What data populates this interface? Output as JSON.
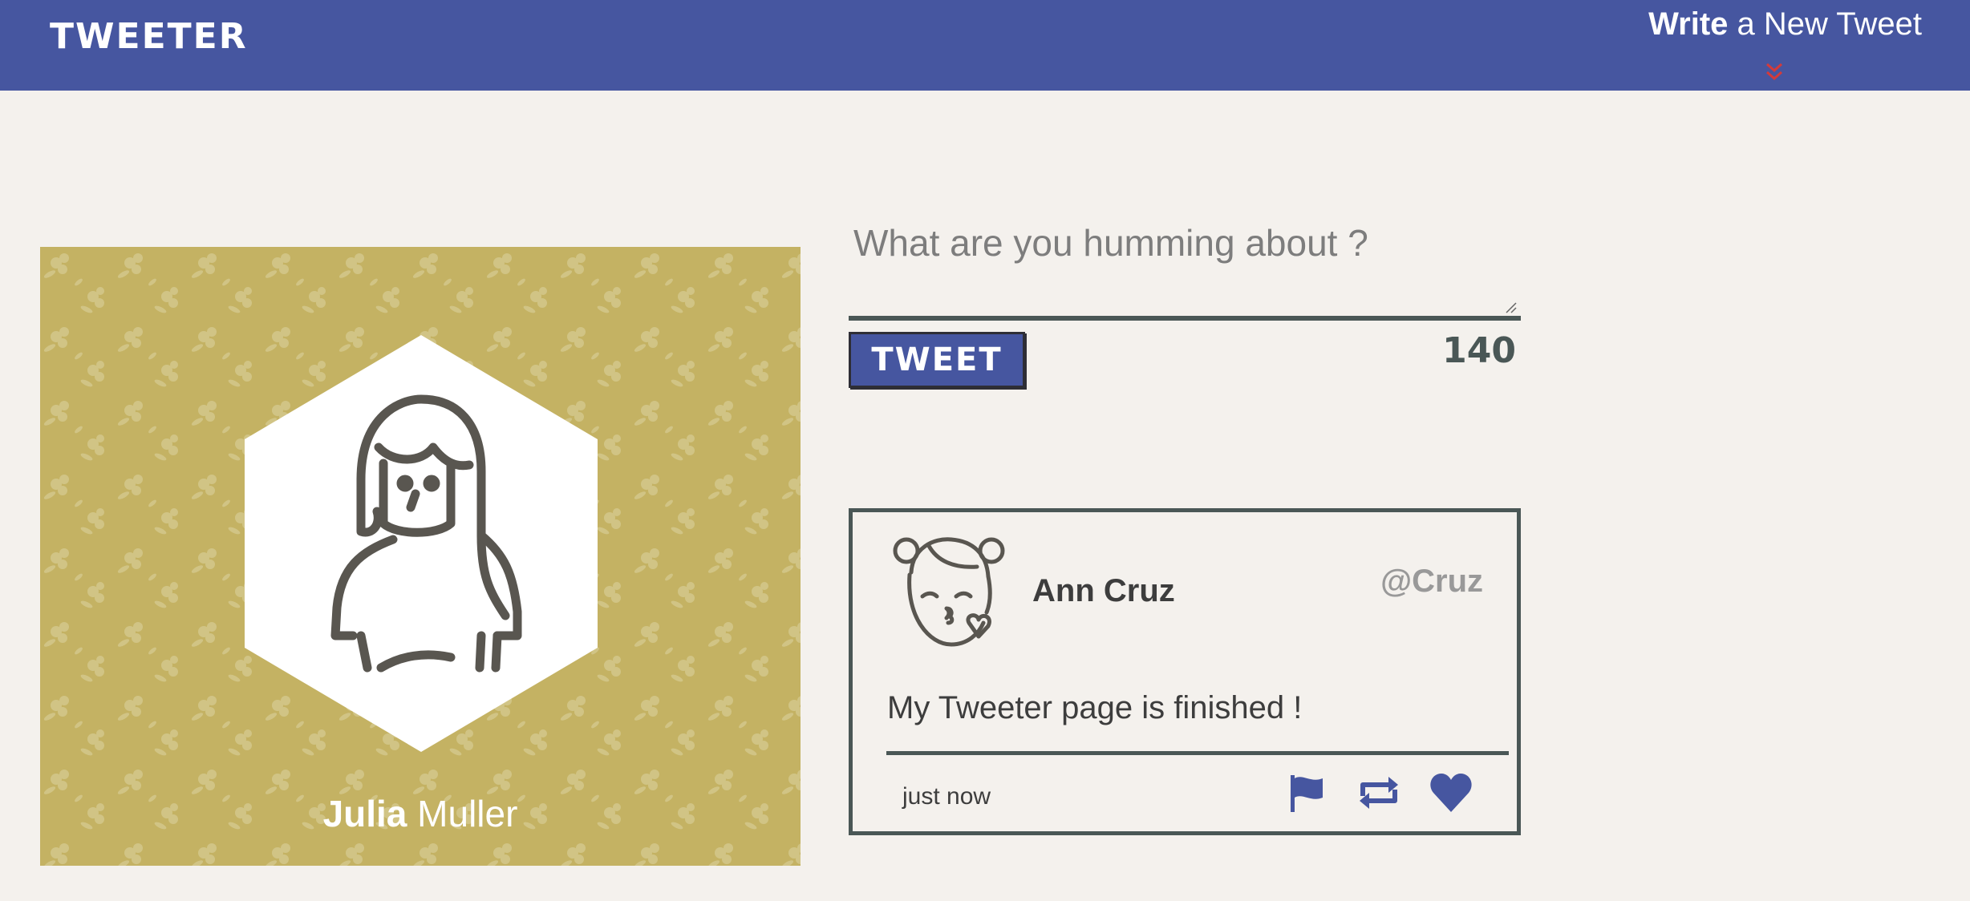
{
  "app": {
    "logo": "TWEETER",
    "nav_toggle": {
      "bold": "Write",
      "rest": " a New Tweet"
    }
  },
  "profile": {
    "first_name": "Julia",
    "last_name": " Muller"
  },
  "composer": {
    "placeholder": "What are you humming about ?",
    "button_label": "TWEET",
    "char_count": "140"
  },
  "tweet": {
    "name": "Ann Cruz",
    "handle": "@Cruz",
    "text": "My Tweeter page is finished !",
    "time": "just now",
    "actions": [
      "flag-icon",
      "retweet-icon",
      "heart-icon"
    ]
  },
  "colors": {
    "nav": "#4656a0",
    "page_bg": "#f4f1ed",
    "profile_bg": "#c4b263",
    "border": "#4a5756",
    "chevron": "#d43a3a"
  }
}
